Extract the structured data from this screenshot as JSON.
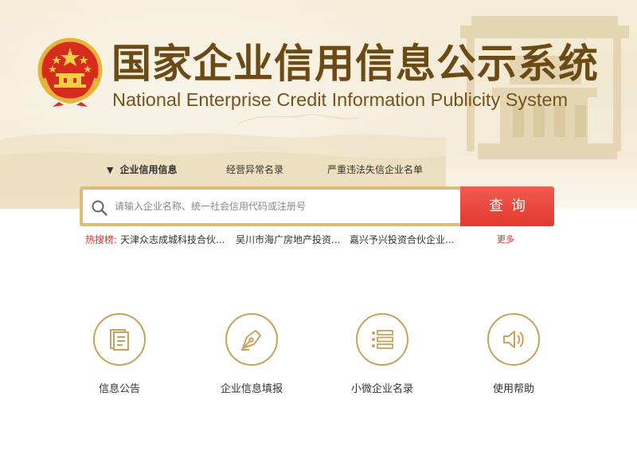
{
  "header": {
    "title_cn": "国家企业信用信息公示系统",
    "title_en": "National Enterprise Credit Information Publicity System"
  },
  "tabs": [
    {
      "label": "企业信用信息",
      "active": true
    },
    {
      "label": "经营异常名录",
      "active": false
    },
    {
      "label": "严重违法失信企业名单",
      "active": false
    }
  ],
  "search": {
    "placeholder": "请输入企业名称、统一社会信用代码或注册号",
    "value": "",
    "button_label": "查询"
  },
  "hot_search": {
    "label": "热搜榜:",
    "items": [
      "天津众志成城科技合伙...",
      "吴川市海广房地产投资...",
      "嘉兴予兴投资合伙企业..."
    ],
    "more_label": "更多"
  },
  "features": [
    {
      "label": "信息公告",
      "icon": "document-icon"
    },
    {
      "label": "企业信息填报",
      "icon": "pen-nib-icon"
    },
    {
      "label": "小微企业名录",
      "icon": "list-icon"
    },
    {
      "label": "使用帮助",
      "icon": "speaker-icon"
    }
  ],
  "colors": {
    "brand_brown": "#6b4a16",
    "gold": "#c7a25c",
    "search_red": "#e3392f",
    "hot_red": "#d6322a"
  }
}
